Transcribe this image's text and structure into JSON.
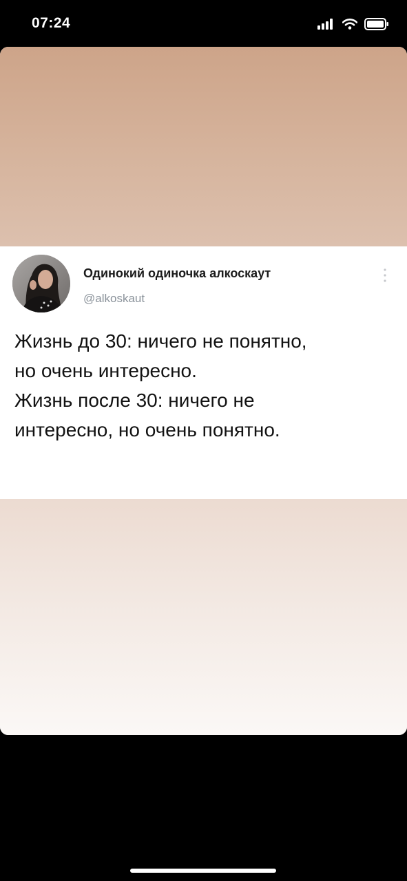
{
  "status_bar": {
    "time": "07:24",
    "icons": [
      "signal-icon",
      "wifi-icon",
      "battery-icon"
    ]
  },
  "colors": {
    "top_gradient_start": "#cda489",
    "top_gradient_end": "#dcc0ae",
    "bottom_gradient_start": "#ecdbd1",
    "bottom_gradient_end": "#fbf8f6",
    "text_primary": "#121212",
    "text_secondary": "#8a929a"
  },
  "tweet": {
    "author_name": "Одинокий одиночка алкоскаут",
    "author_handle": "@alkoskaut",
    "text_lines": [
      "Жизнь до 30: ничего не понятно,",
      "но очень интересно.",
      "Жизнь после 30: ничего не",
      "интересно, но очень понятно."
    ]
  }
}
